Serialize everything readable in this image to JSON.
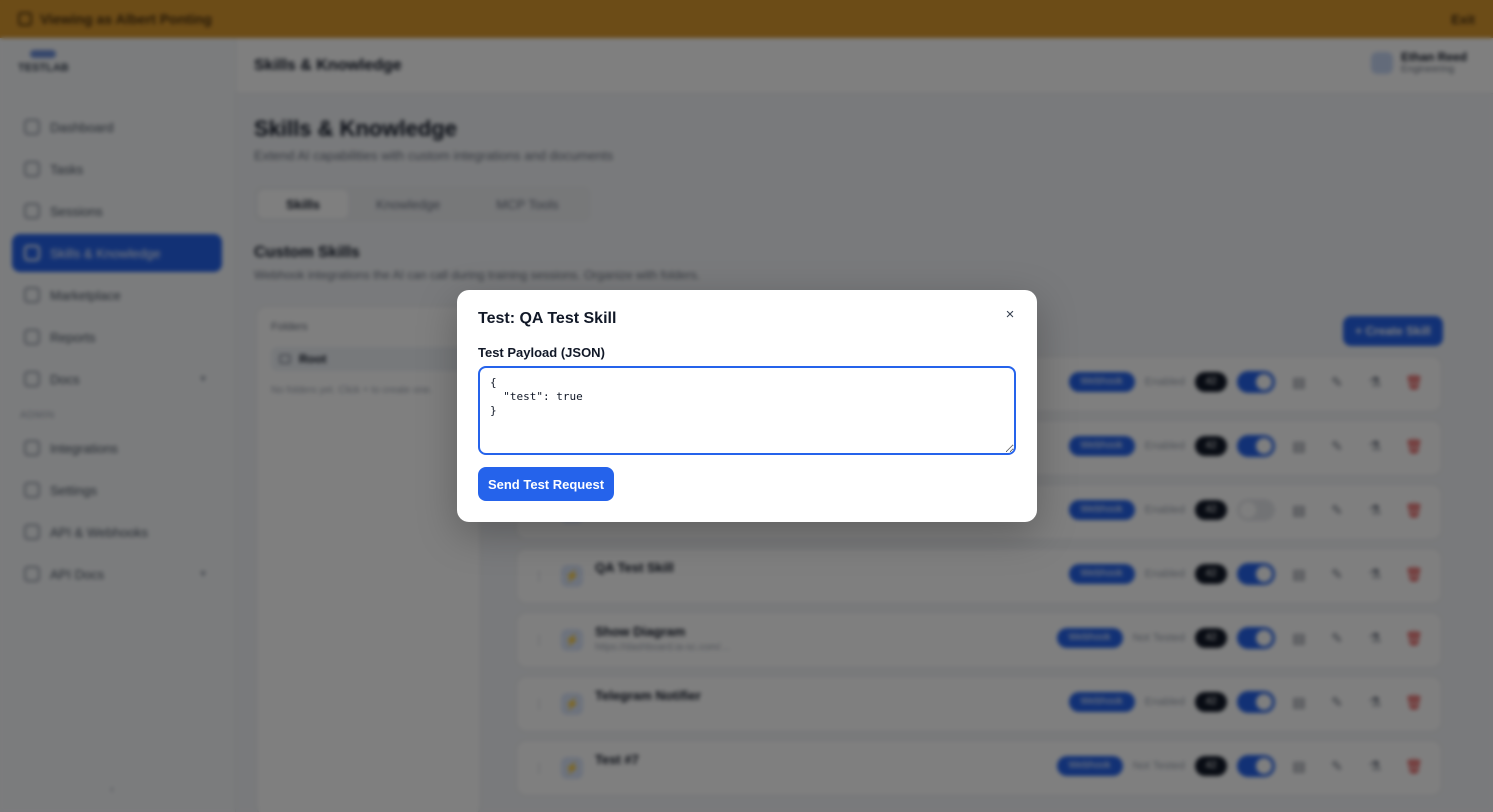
{
  "banner": {
    "text": "Viewing as Albert Ponting",
    "exit_label": "Exit"
  },
  "sidebar": {
    "logo": "TESTLAB",
    "items": [
      {
        "label": "Dashboard"
      },
      {
        "label": "Tasks"
      },
      {
        "label": "Sessions"
      },
      {
        "label": "Skills & Knowledge",
        "active": true
      },
      {
        "label": "Marketplace"
      },
      {
        "label": "Reports"
      },
      {
        "label": "Docs"
      }
    ],
    "section_label": "ADMIN",
    "admin_items": [
      {
        "label": "Integrations"
      },
      {
        "label": "Settings"
      },
      {
        "label": "API & Webhooks"
      },
      {
        "label": "API Docs"
      }
    ],
    "collapse": "‹"
  },
  "header": {
    "title": "Skills & Knowledge",
    "user_name": "Ethan Reed",
    "user_role": "Engineering"
  },
  "main": {
    "title": "Skills & Knowledge",
    "subtitle": "Extend AI capabilities with custom integrations and documents",
    "tabs": [
      {
        "label": "Skills",
        "active": true
      },
      {
        "label": "Knowledge"
      },
      {
        "label": "MCP Tools"
      }
    ],
    "section_title": "Custom Skills",
    "section_subtitle": "Webhook integrations the AI can call during training sessions. Organize with folders.",
    "folders": {
      "label": "Folders",
      "root": "Root",
      "hint": "No folders yet. Click + to create one."
    },
    "create_label": "+ Create Skill",
    "skills": [
      {
        "name": "",
        "desc": "",
        "pill": "Webhook",
        "meta": "Enabled",
        "count": "42",
        "enabled": true
      },
      {
        "name": "",
        "desc": "",
        "pill": "Webhook",
        "meta": "Enabled",
        "count": "42",
        "enabled": true
      },
      {
        "name": "",
        "desc": "",
        "pill": "Webhook",
        "meta": "Enabled",
        "count": "42",
        "enabled": false
      },
      {
        "name": "QA Test Skill",
        "desc": "",
        "pill": "Webhook",
        "meta": "Enabled",
        "count": "42",
        "enabled": true
      },
      {
        "name": "Show Diagram",
        "desc": "https://dashboard.ia-sc.com/…",
        "pill": "Webhook",
        "meta": "Not Tested",
        "count": "42",
        "enabled": true
      },
      {
        "name": "Telegram Notifier",
        "desc": "",
        "pill": "Webhook",
        "meta": "Enabled",
        "count": "42",
        "enabled": true
      },
      {
        "name": "Test #7",
        "desc": "",
        "pill": "Webhook",
        "meta": "Not Tested",
        "count": "42",
        "enabled": true
      }
    ]
  },
  "modal": {
    "title": "Test: QA Test Skill",
    "close_icon": "×",
    "field_label": "Test Payload (JSON)",
    "payload_value": "{\n  \"test\": true\n}",
    "send_label": "Send Test Request"
  },
  "colors": {
    "accent": "#2563eb",
    "banner": "#d9982f"
  }
}
